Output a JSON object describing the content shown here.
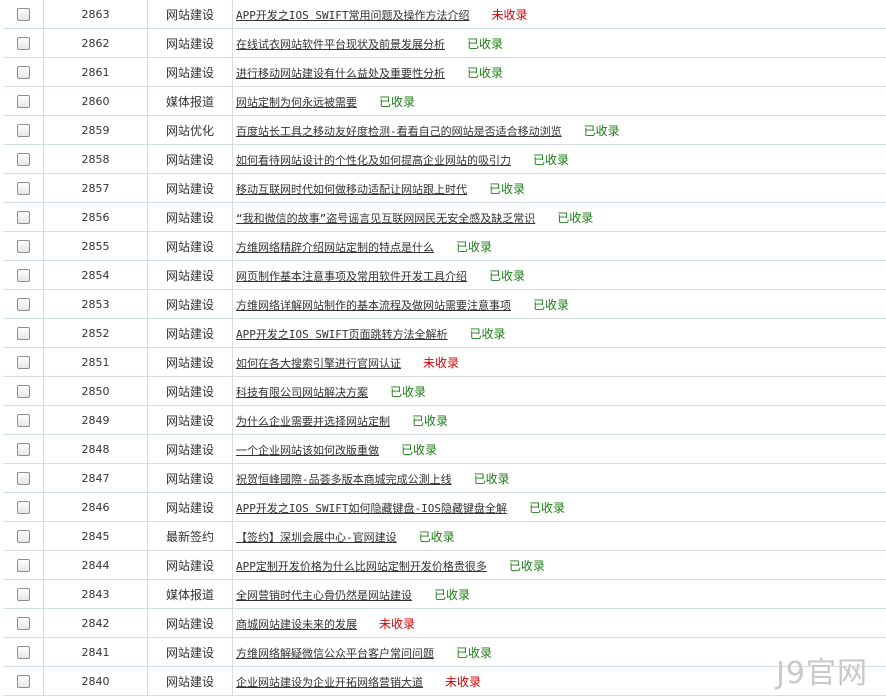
{
  "rows": [
    {
      "id": "2863",
      "category": "网站建设",
      "title": "APP开发之IOS SWIFT常用问题及操作方法介绍",
      "status": "未收录",
      "status_type": "no"
    },
    {
      "id": "2862",
      "category": "网站建设",
      "title": "在线试衣网站软件平台现状及前景发展分析",
      "status": "已收录",
      "status_type": "ok"
    },
    {
      "id": "2861",
      "category": "网站建设",
      "title": "进行移动网站建设有什么益处及重要性分析",
      "status": "已收录",
      "status_type": "ok"
    },
    {
      "id": "2860",
      "category": "媒体报道",
      "title": "网站定制为何永远被需要",
      "status": "已收录",
      "status_type": "ok"
    },
    {
      "id": "2859",
      "category": "网站优化",
      "title": "百度站长工具之移动友好度检测-看看自己的网站是否适合移动浏览",
      "status": "已收录",
      "status_type": "ok"
    },
    {
      "id": "2858",
      "category": "网站建设",
      "title": "如何看待网站设计的个性化及如何提高企业网站的吸引力",
      "status": "已收录",
      "status_type": "ok"
    },
    {
      "id": "2857",
      "category": "网站建设",
      "title": "移动互联网时代如何做移动适配让网站跟上时代",
      "status": "已收录",
      "status_type": "ok"
    },
    {
      "id": "2856",
      "category": "网站建设",
      "title": "“我和微信的故事”盗号谣言见互联网网民无安全感及缺乏常识",
      "status": "已收录",
      "status_type": "ok"
    },
    {
      "id": "2855",
      "category": "网站建设",
      "title": "方维网络精辟介绍网站定制的特点是什么",
      "status": "已收录",
      "status_type": "ok"
    },
    {
      "id": "2854",
      "category": "网站建设",
      "title": "网页制作基本注意事项及常用软件开发工具介绍",
      "status": "已收录",
      "status_type": "ok"
    },
    {
      "id": "2853",
      "category": "网站建设",
      "title": "方维网络详解网站制作的基本流程及做网站需要注意事项",
      "status": "已收录",
      "status_type": "ok"
    },
    {
      "id": "2852",
      "category": "网站建设",
      "title": "APP开发之IOS SWIFT页面跳转方法全解析",
      "status": "已收录",
      "status_type": "ok"
    },
    {
      "id": "2851",
      "category": "网站建设",
      "title": "如何在各大搜索引擎进行官网认证",
      "status": "未收录",
      "status_type": "no"
    },
    {
      "id": "2850",
      "category": "网站建设",
      "title": "科技有限公司网站解决方案",
      "status": "已收录",
      "status_type": "ok"
    },
    {
      "id": "2849",
      "category": "网站建设",
      "title": "为什么企业需要并选择网站定制",
      "status": "已收录",
      "status_type": "ok"
    },
    {
      "id": "2848",
      "category": "网站建设",
      "title": "一个企业网站该如何改版重做",
      "status": "已收录",
      "status_type": "ok"
    },
    {
      "id": "2847",
      "category": "网站建设",
      "title": "祝贺恒峰國際-品荟多版本商城完成公測上线",
      "status": "已收录",
      "status_type": "ok"
    },
    {
      "id": "2846",
      "category": "网站建设",
      "title": "APP开发之IOS SWIFT如何隐藏键盘-IOS隐藏键盘全解",
      "status": "已收录",
      "status_type": "ok"
    },
    {
      "id": "2845",
      "category": "最新签约",
      "title": "【签约】深圳会展中心-官网建设",
      "status": "已收录",
      "status_type": "ok"
    },
    {
      "id": "2844",
      "category": "网站建设",
      "title": "APP定制开发价格为什么比网站定制开发价格贵很多",
      "status": "已收录",
      "status_type": "ok"
    },
    {
      "id": "2843",
      "category": "媒体报道",
      "title": "全网营销时代主心骨仍然是网站建设",
      "status": "已收录",
      "status_type": "ok"
    },
    {
      "id": "2842",
      "category": "网站建设",
      "title": "商城网站建设未来的发展",
      "status": "未收录",
      "status_type": "no"
    },
    {
      "id": "2841",
      "category": "网站建设",
      "title": "方维网络解疑微信公众平台客户常问问题",
      "status": "已收录",
      "status_type": "ok"
    },
    {
      "id": "2840",
      "category": "网站建设",
      "title": "企业网站建设为企业开拓网络营销大道",
      "status": "未收录",
      "status_type": "no"
    }
  ],
  "watermark": "J9官网",
  "colors": {
    "indexed": "#1b7d14",
    "not_indexed": "#d60000",
    "grid": "#d4dce8"
  }
}
